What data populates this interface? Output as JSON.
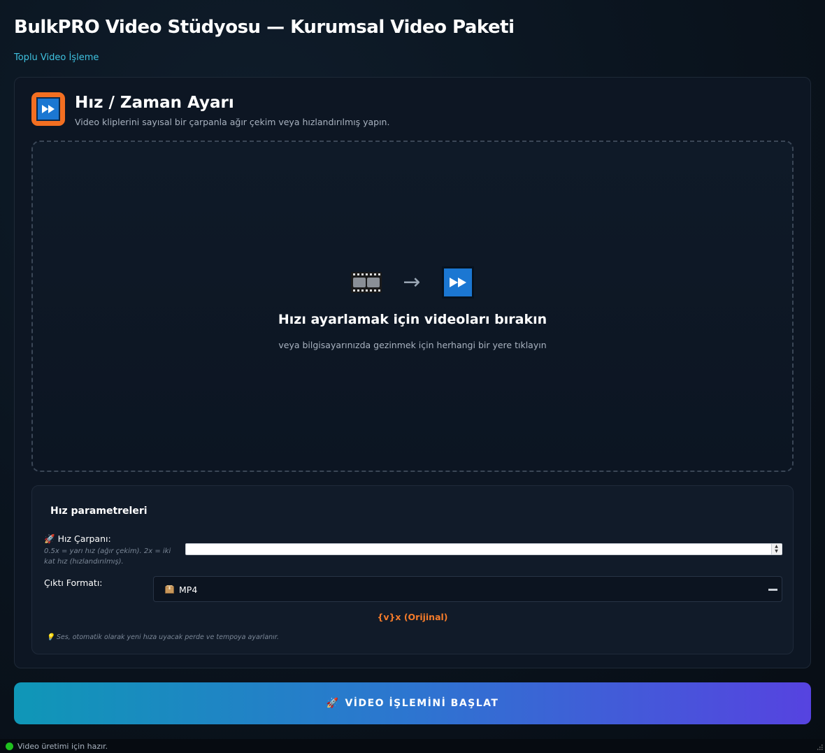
{
  "app": {
    "title": "BulkPRO Video Stüdyosu — Kurumsal Video Paketi",
    "breadcrumb": "Toplu Video İşleme"
  },
  "tool": {
    "icon": "fast-forward-icon",
    "title": "Hız / Zaman Ayarı",
    "description": "Video kliplerini sayısal bir çarpanla ağır çekim veya hızlandırılmış yapın."
  },
  "dropzone": {
    "icons": [
      "film-icon",
      "arrow-right-icon",
      "fast-forward-icon"
    ],
    "arrow": "→",
    "title": "Hızı ayarlamak için videoları bırakın",
    "subtitle": "veya bilgisayarınızda gezinmek için herhangi bir yere tıklayın"
  },
  "params": {
    "title": "Hız parametreleri",
    "speed": {
      "icon": "rocket-icon",
      "label": "Hız Çarpanı:",
      "hint": "0.5x = yarı hız (ağır çekim). 2x = iki kat hız (hızlandırılmış).",
      "value": ""
    },
    "format": {
      "label": "Çıktı Formatı:",
      "icon": "package-icon",
      "selected": "MP4"
    },
    "readout": "{v}x (Orijinal)",
    "note": "💡 Ses, otomatik olarak yeni hıza uyacak perde ve tempoya ayarlanır."
  },
  "actions": {
    "start_label": "VİDEO İŞLEMİNİ BAŞLAT",
    "start_icon": "rocket-icon"
  },
  "status": {
    "text": "Video üretimi için hazır.",
    "indicator_color": "#1fc01f"
  },
  "colors": {
    "accent_cyan": "#3fc2e0",
    "accent_orange": "#f47b2a",
    "icon_orange": "#f36f21",
    "icon_blue": "#1b77d2"
  }
}
